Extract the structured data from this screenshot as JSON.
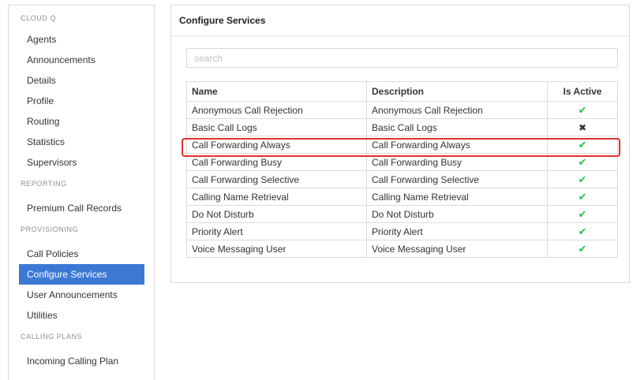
{
  "sidebar": {
    "sections": [
      {
        "title": "CLOUD Q",
        "items": [
          "Agents",
          "Announcements",
          "Details",
          "Profile",
          "Routing",
          "Statistics",
          "Supervisors"
        ]
      },
      {
        "title": "REPORTING",
        "items": [
          "Premium Call Records"
        ]
      },
      {
        "title": "PROVISIONING",
        "items": [
          "Call Policies",
          "Configure Services",
          "User Announcements",
          "Utilities"
        ]
      },
      {
        "title": "CALLING PLANS",
        "items": [
          "Incoming Calling Plan"
        ]
      }
    ],
    "active_item": "Configure Services"
  },
  "panel": {
    "title": "Configure Services",
    "search_placeholder": "search",
    "columns": [
      "Name",
      "Description",
      "Is Active"
    ],
    "rows": [
      {
        "name": "Anonymous Call Rejection",
        "description": "Anonymous Call Rejection",
        "active": true
      },
      {
        "name": "Basic Call Logs",
        "description": "Basic Call Logs",
        "active": false
      },
      {
        "name": "Call Forwarding Always",
        "description": "Call Forwarding Always",
        "active": true,
        "highlighted": true
      },
      {
        "name": "Call Forwarding Busy",
        "description": "Call Forwarding Busy",
        "active": true
      },
      {
        "name": "Call Forwarding Selective",
        "description": "Call Forwarding Selective",
        "active": true
      },
      {
        "name": "Calling Name Retrieval",
        "description": "Calling Name Retrieval",
        "active": true
      },
      {
        "name": "Do Not Disturb",
        "description": "Do Not Disturb",
        "active": true
      },
      {
        "name": "Priority Alert",
        "description": "Priority Alert",
        "active": true
      },
      {
        "name": "Voice Messaging User",
        "description": "Voice Messaging User",
        "active": true
      }
    ]
  },
  "colors": {
    "active_item_bg": "#3c79d5",
    "check": "#2dbe4e",
    "highlight_border": "#e0322e"
  }
}
